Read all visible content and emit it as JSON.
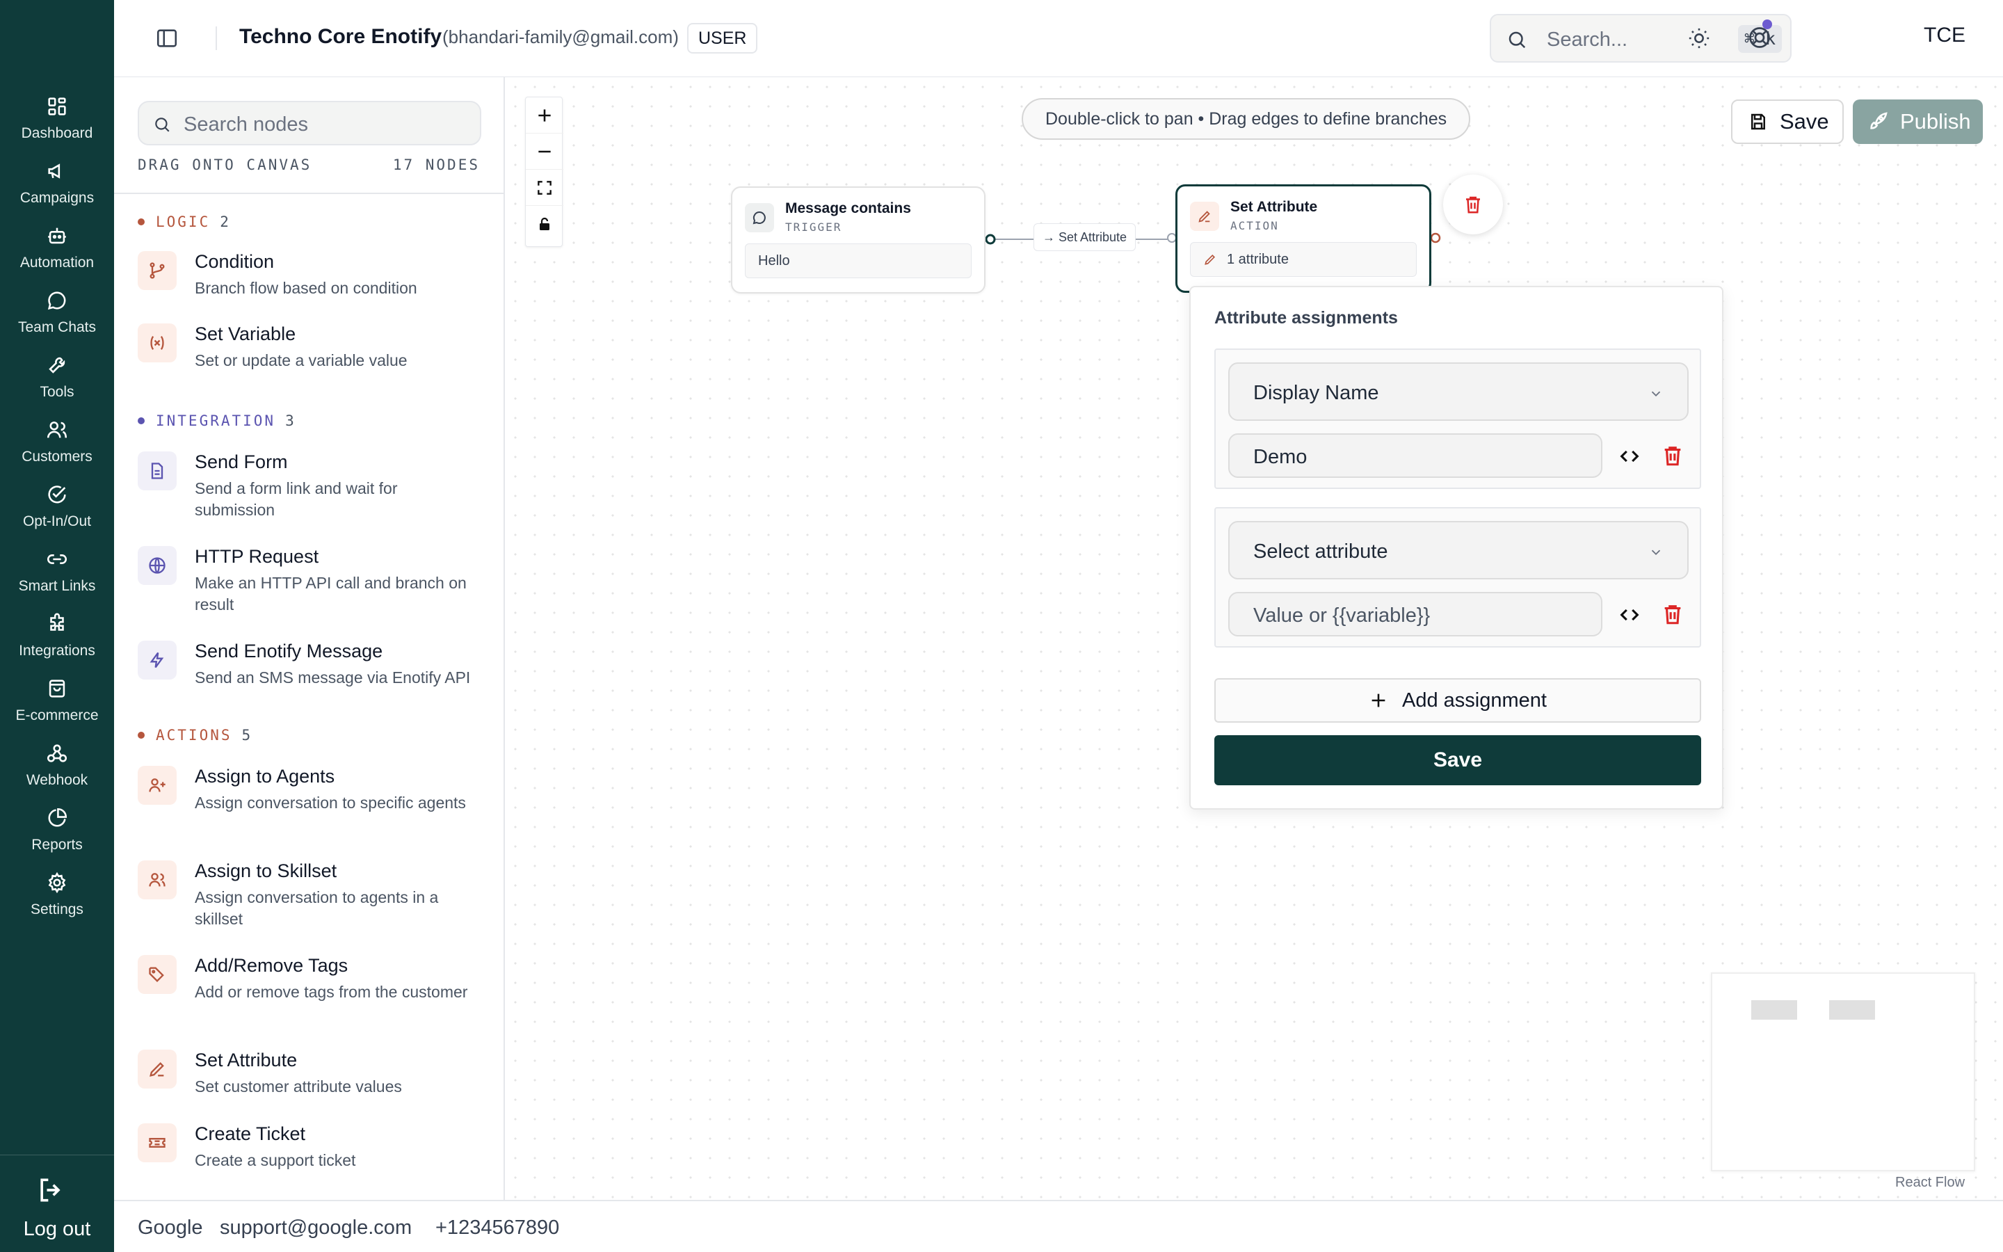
{
  "nav": {
    "items": [
      {
        "label": "Dashboard",
        "icon": "dashboard-icon"
      },
      {
        "label": "Campaigns",
        "icon": "megaphone-icon"
      },
      {
        "label": "Automation",
        "icon": "bot-icon"
      },
      {
        "label": "Team Chats",
        "icon": "chat-icon"
      },
      {
        "label": "Tools",
        "icon": "wrench-icon"
      },
      {
        "label": "Customers",
        "icon": "users-icon"
      },
      {
        "label": "Opt-In/Out",
        "icon": "check-circle-icon"
      },
      {
        "label": "Smart Links",
        "icon": "link-icon"
      },
      {
        "label": "Integrations",
        "icon": "puzzle-icon"
      },
      {
        "label": "E-commerce",
        "icon": "shopping-bag-icon"
      },
      {
        "label": "Webhook",
        "icon": "webhook-icon"
      },
      {
        "label": "Reports",
        "icon": "pie-chart-icon"
      },
      {
        "label": "Settings",
        "icon": "gear-icon"
      }
    ],
    "logout_label": "Log out"
  },
  "header": {
    "org_name": "Techno Core Enotify",
    "org_email": "(bhandari-family@gmail.com)",
    "role": "USER",
    "search_placeholder": "Search...",
    "search_shortcut": "⌘ k",
    "avatar": "TCE"
  },
  "panel": {
    "search_placeholder": "Search nodes",
    "drag_hint": "DRAG ONTO CANVAS",
    "node_count": "17 NODES",
    "categories": [
      {
        "name": "LOGIC",
        "count": "2",
        "color": "#b5563d"
      },
      {
        "name": "INTEGRATION",
        "count": "3",
        "color": "#5b54b0"
      },
      {
        "name": "ACTIONS",
        "count": "5",
        "color": "#b5563d"
      }
    ],
    "nodes": [
      {
        "title": "Condition",
        "desc": "Branch flow based on condition",
        "icon": "branch-icon"
      },
      {
        "title": "Set Variable",
        "desc": "Set or update a variable value",
        "icon": "variable-icon"
      },
      {
        "title": "Send Form",
        "desc": "Send a form link and wait for submission",
        "icon": "form-icon"
      },
      {
        "title": "HTTP Request",
        "desc": "Make an HTTP API call and branch on result",
        "icon": "globe-icon"
      },
      {
        "title": "Send Enotify Message",
        "desc": "Send an SMS message via Enotify API",
        "icon": "lightning-icon"
      },
      {
        "title": "Assign to Agents",
        "desc": "Assign conversation to specific agents",
        "icon": "user-plus-icon"
      },
      {
        "title": "Assign to Skillset",
        "desc": "Assign conversation to agents in a skillset",
        "icon": "users-icon"
      },
      {
        "title": "Add/Remove Tags",
        "desc": "Add or remove tags from the customer",
        "icon": "tags-icon"
      },
      {
        "title": "Set Attribute",
        "desc": "Set customer attribute values",
        "icon": "pencil-icon"
      },
      {
        "title": "Create Ticket",
        "desc": "Create a support ticket",
        "icon": "ticket-icon"
      }
    ]
  },
  "canvas": {
    "hint": "Double-click to pan • Drag edges to define branches",
    "save_label": "Save",
    "publish_label": "Publish",
    "trigger_node": {
      "title": "Message contains",
      "type": "TRIGGER",
      "value": "Hello"
    },
    "action_node": {
      "title": "Set Attribute",
      "type": "ACTION",
      "summary": "1 attribute"
    },
    "edge_label": "→ Set Attribute",
    "attribution": "React Flow"
  },
  "attribute_popover": {
    "title": "Attribute assignments",
    "assignments": [
      {
        "attribute": "Display Name",
        "value": "Demo"
      },
      {
        "attribute": "Select attribute",
        "value_placeholder": "Value or {{variable}}"
      }
    ],
    "add_label": "Add assignment",
    "save_label": "Save"
  },
  "footer": {
    "company": "Google",
    "email": "support@google.com",
    "phone": "+1234567890"
  },
  "colors": {
    "brand_dark": "#0f3b3a",
    "publish_disabled": "#89a4a1",
    "accent_logic": "#b5563d",
    "accent_integration": "#5b54b0",
    "danger": "#dc2626"
  }
}
